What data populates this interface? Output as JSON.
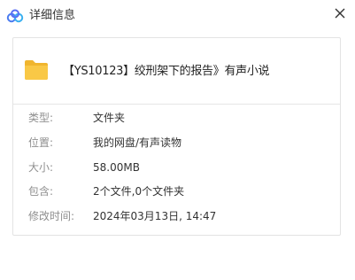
{
  "window": {
    "title": "详细信息",
    "app_icon": "cloud-icon",
    "close_icon": "close-icon"
  },
  "file": {
    "icon": "folder-icon",
    "name": "【YS10123】绞刑架下的报告》有声小说"
  },
  "details": [
    {
      "label": "类型:",
      "value": "文件夹"
    },
    {
      "label": "位置:",
      "value": "我的网盘/有声读物"
    },
    {
      "label": "大小:",
      "value": "58.00MB"
    },
    {
      "label": "包含:",
      "value": "2个文件,0个文件夹"
    },
    {
      "label": "修改时间:",
      "value": "2024年03月13日, 14:47"
    }
  ],
  "colors": {
    "folder": "#f9c846",
    "cloud_accent": "#4a7bf0"
  }
}
